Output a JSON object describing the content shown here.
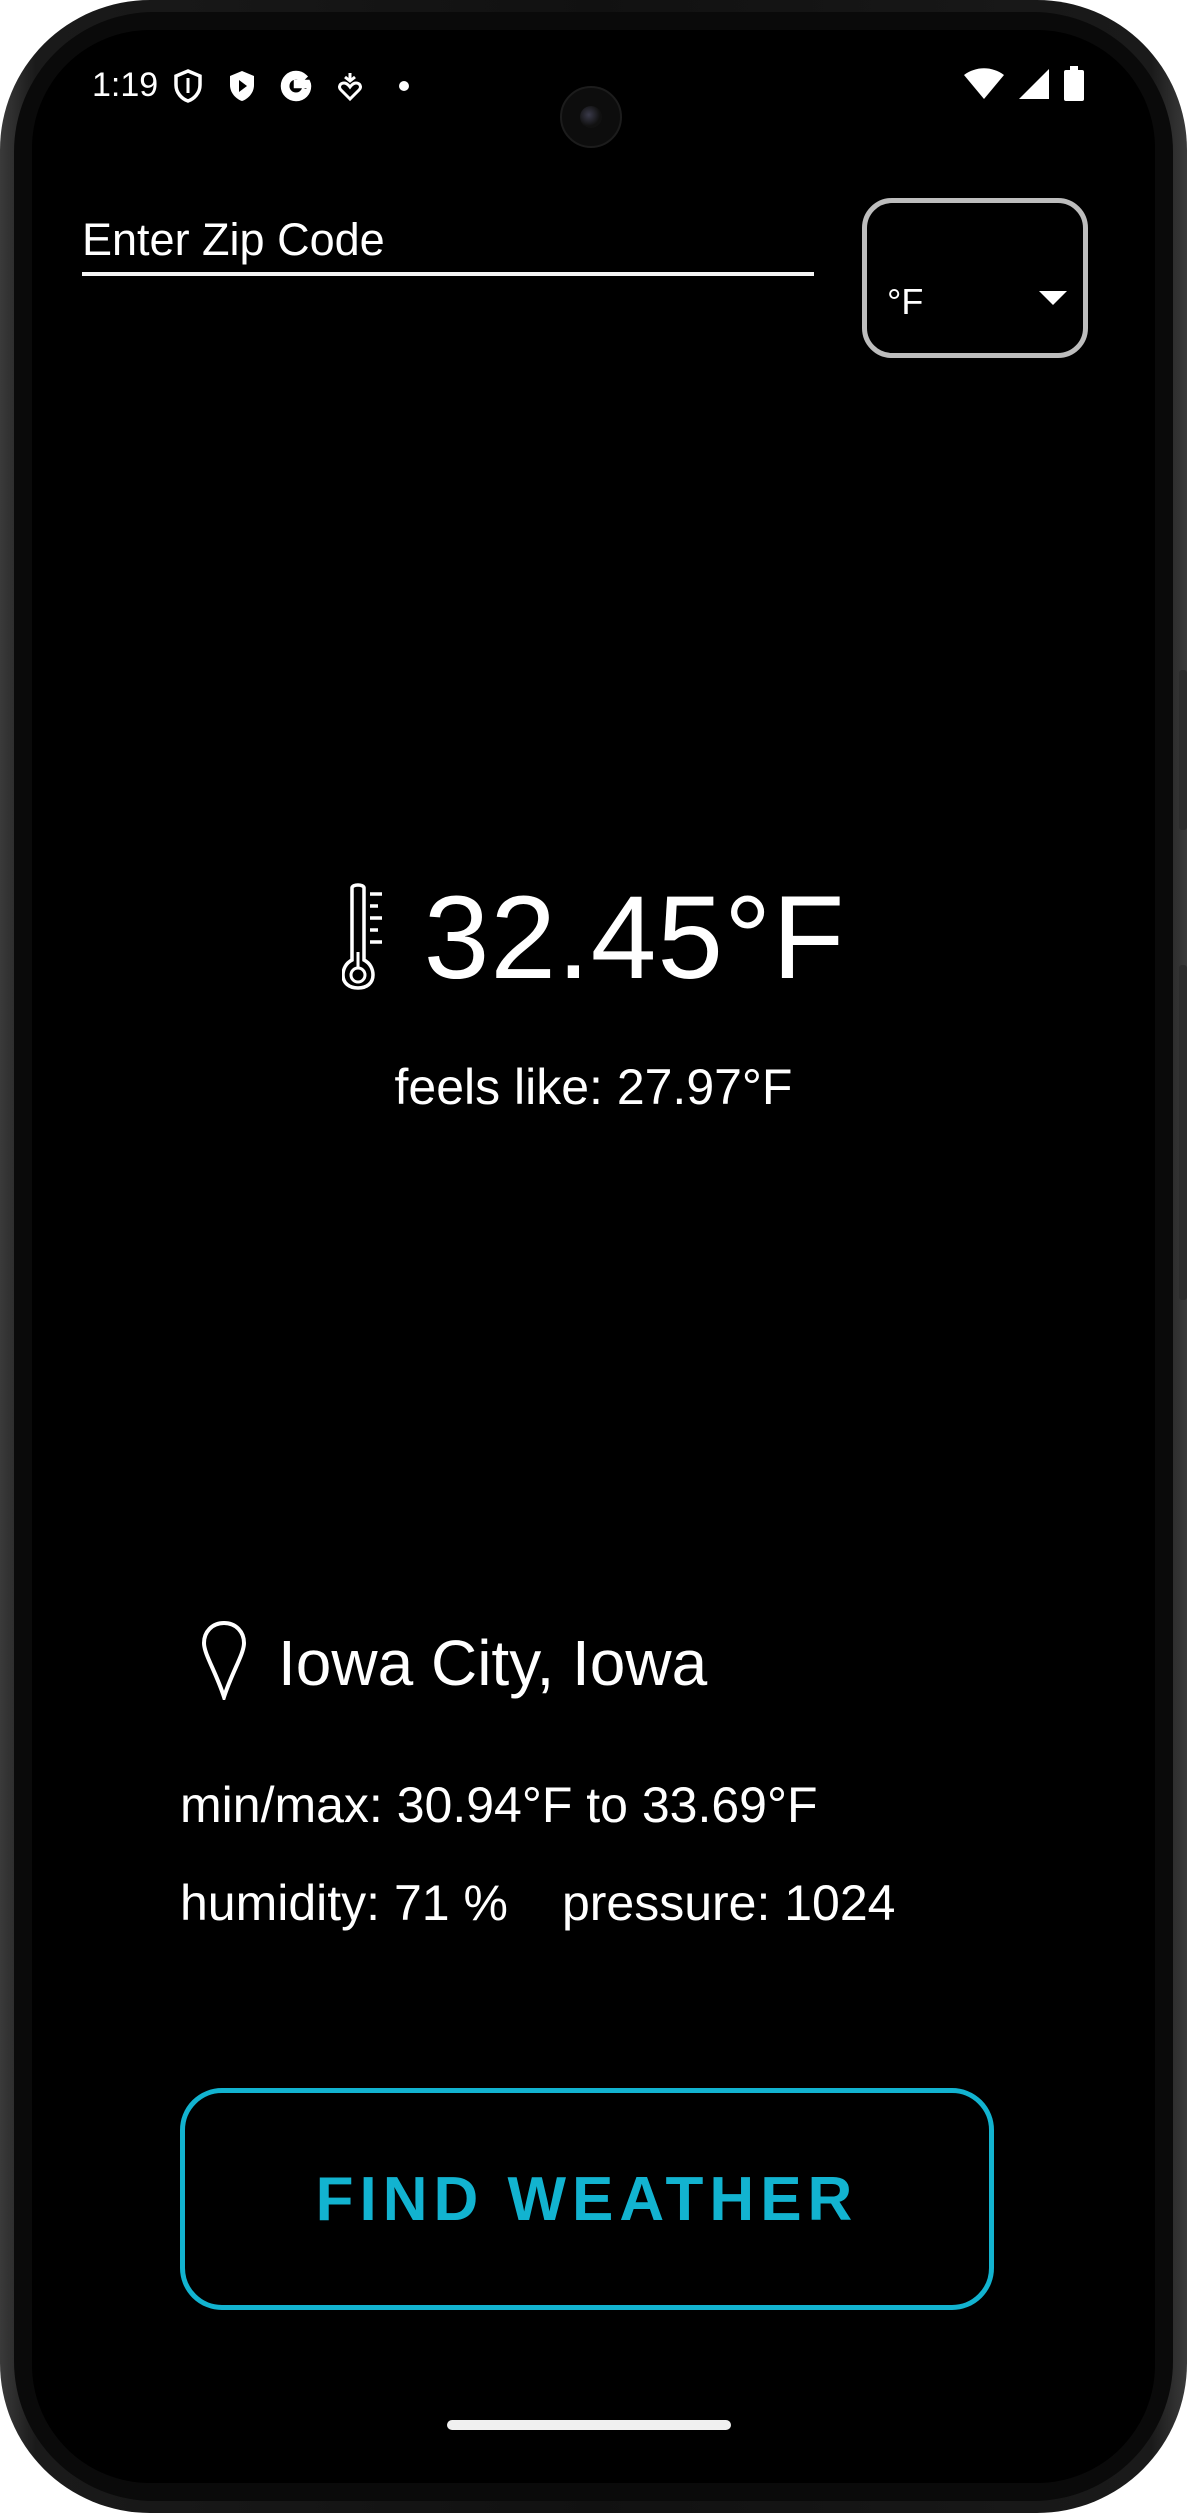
{
  "status_bar": {
    "time": "1:19",
    "left_icons": [
      "shield-outline-icon",
      "shield-play-icon",
      "google-g-icon",
      "download-heart-icon",
      "dot-icon"
    ],
    "right_icons": [
      "wifi-icon",
      "cell-signal-icon",
      "battery-icon"
    ]
  },
  "zip_input": {
    "placeholder": "Enter Zip Code",
    "value": ""
  },
  "unit_select": {
    "selected": "°F"
  },
  "weather": {
    "temperature": "32.45°F",
    "feels_like": "feels like: 27.97°F",
    "location": "Iowa City, Iowa",
    "min_max": "min/max: 30.94°F to 33.69°F",
    "humidity": "humidity: 71 %",
    "pressure": "pressure: 1024"
  },
  "actions": {
    "find_label": "FIND WEATHER"
  },
  "colors": {
    "background": "#000000",
    "text": "#ffffff",
    "accent": "#12b3d0",
    "select_border": "#bdbdbd"
  }
}
